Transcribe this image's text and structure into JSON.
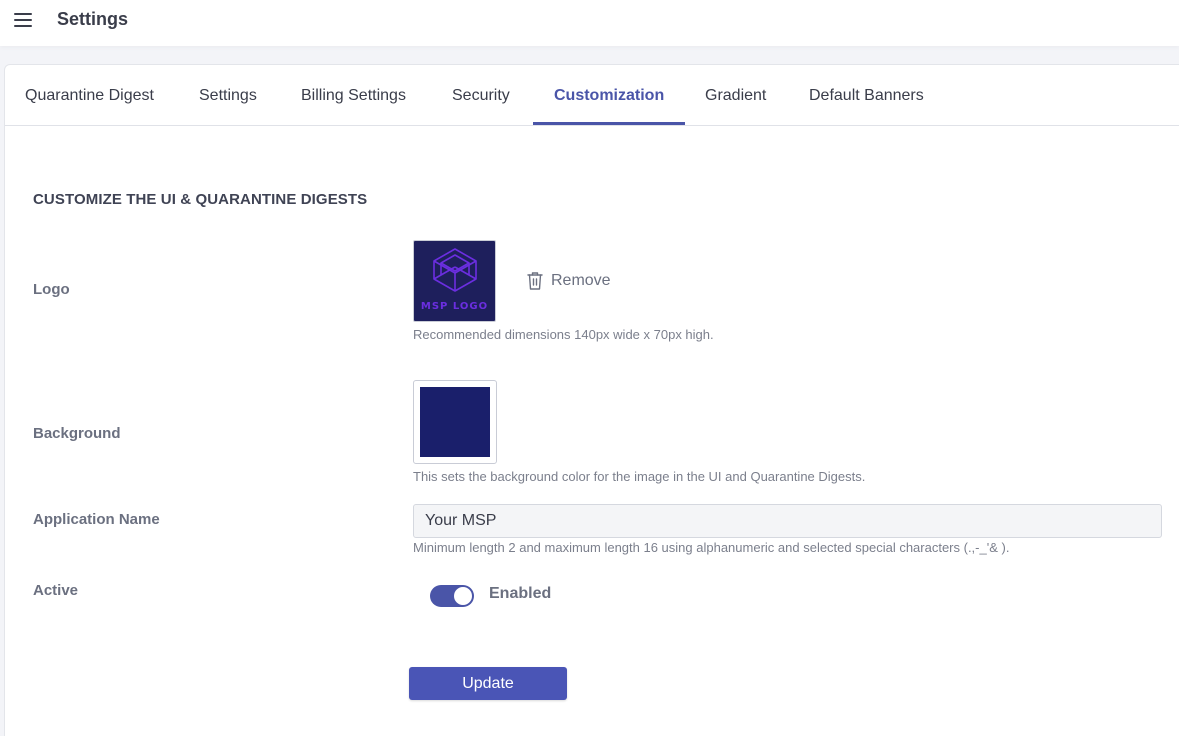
{
  "header": {
    "title": "Settings",
    "menu_icon": "hamburger-menu-icon"
  },
  "tabs": [
    {
      "label": "Quarantine Digest",
      "active": false
    },
    {
      "label": "Settings",
      "active": false
    },
    {
      "label": "Billing Settings",
      "active": false
    },
    {
      "label": "Security",
      "active": false
    },
    {
      "label": "Customization",
      "active": true
    },
    {
      "label": "Gradient",
      "active": false
    },
    {
      "label": "Default Banners",
      "active": false
    }
  ],
  "section": {
    "title": "CUSTOMIZE THE UI & QUARANTINE DIGESTS"
  },
  "logo": {
    "label": "Logo",
    "logo_text": "MSP LOGO",
    "remove_label": "Remove",
    "remove_icon": "trash-icon",
    "hint": "Recommended dimensions 140px wide x 70px high."
  },
  "background": {
    "label": "Background",
    "color": "#1a1f6b",
    "hint": "This sets the background color for the image in the UI and Quarantine Digests."
  },
  "app_name": {
    "label": "Application Name",
    "value": "Your MSP",
    "hint": "Minimum length 2 and maximum length 16 using alphanumeric and selected special characters (.,-_'& )."
  },
  "active": {
    "label": "Active",
    "enabled": true,
    "status_label": "Enabled"
  },
  "actions": {
    "update_label": "Update"
  },
  "colors": {
    "accent": "#4a55a8",
    "logo_bg": "#1e1f5c",
    "logo_accent": "#6b2ee0"
  }
}
